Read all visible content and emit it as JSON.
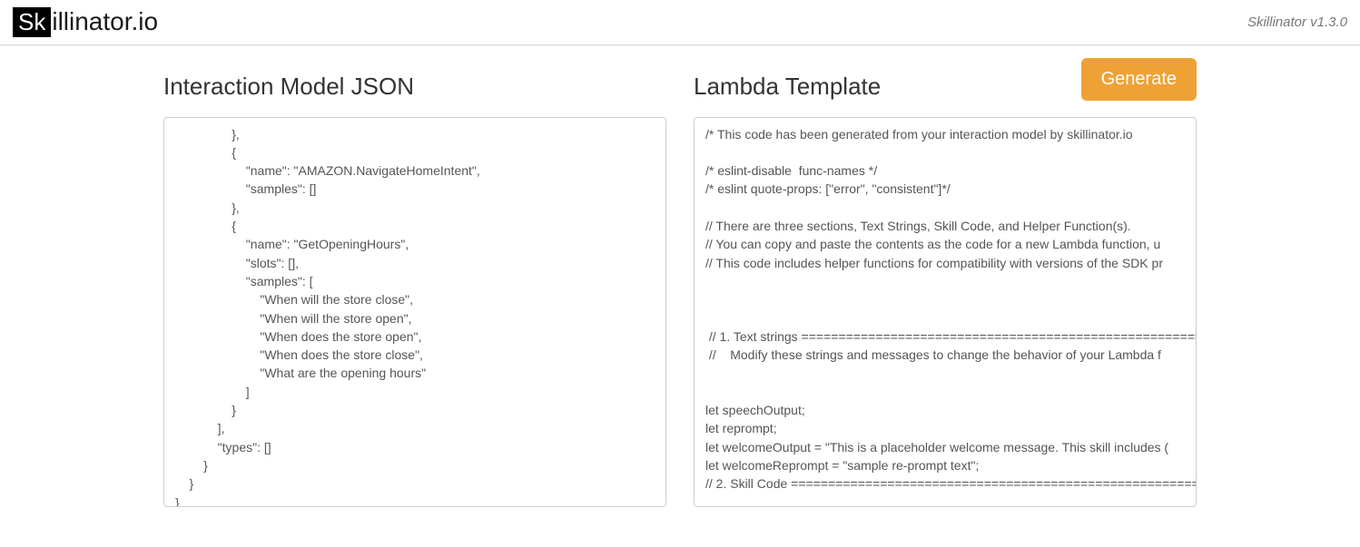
{
  "header": {
    "logo_badge": "Sk",
    "logo_rest": "illinator.io",
    "version": "Skillinator v1.3.0"
  },
  "left_panel": {
    "title": "Interaction Model JSON",
    "content": "                },\n                {\n                    \"name\": \"AMAZON.NavigateHomeIntent\",\n                    \"samples\": []\n                },\n                {\n                    \"name\": \"GetOpeningHours\",\n                    \"slots\": [],\n                    \"samples\": [\n                        \"When will the store close\",\n                        \"When will the store open\",\n                        \"When does the store open\",\n                        \"When does the store close\",\n                        \"What are the opening hours\"\n                    ]\n                }\n            ],\n            \"types\": []\n        }\n    }\n}"
  },
  "right_panel": {
    "title": "Lambda Template",
    "button_label": "Generate",
    "content": "/* This code has been generated from your interaction model by skillinator.io\n\n/* eslint-disable  func-names */\n/* eslint quote-props: [\"error\", \"consistent\"]*/\n\n// There are three sections, Text Strings, Skill Code, and Helper Function(s).\n// You can copy and paste the contents as the code for a new Lambda function, u\n// This code includes helper functions for compatibility with versions of the SDK pr\n\n\n\n // 1. Text strings =======================================================\n //    Modify these strings and messages to change the behavior of your Lambda f\n\n\nlet speechOutput;\nlet reprompt;\nlet welcomeOutput = \"This is a placeholder welcome message. This skill includes (\nlet welcomeReprompt = \"sample re-prompt text\";\n// 2. Skill Code ========================================================="
  }
}
